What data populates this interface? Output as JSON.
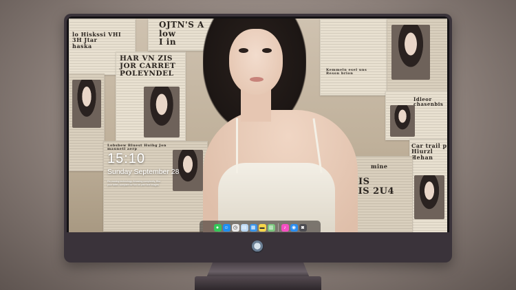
{
  "lockscreen": {
    "time": "15:10",
    "date": "Sunday September 28",
    "note_lines": [
      "Re-moving technology, Amazing complexity, Blur",
      "your label, compare for fun on prev line images"
    ]
  },
  "wallpaper": {
    "headlines": {
      "top_center": "OJTN'S A\nlow\nI in",
      "left_big": "HAR VN ZIS\nJOR CARRET\nPOLEYNDEL",
      "top_left": "lo Hiskssi VHI\n3H Jtar\nhaska",
      "mid_left": "Lobsbew Bluest Huibg Jon\nmaunetl aerp",
      "right_car": "Car trail p\nHiurzl\nЯehan",
      "right_mid": "Idleor\nchasenbis",
      "right_small": "Kemmeln esel uns\nReson brion",
      "bottom_right": "ZIS\nLIS 2U4",
      "right_mine": "mine"
    }
  },
  "dock": {
    "apps": [
      {
        "name": "messages",
        "glyph": "●",
        "color": "#34c759"
      },
      {
        "name": "finder",
        "glyph": "☺",
        "color": "#1e8ef0"
      },
      {
        "name": "clock",
        "glyph": "◷",
        "color": "#e8e8e8"
      },
      {
        "name": "preview",
        "glyph": "▤",
        "color": "#b9d6f2"
      },
      {
        "name": "claquette",
        "glyph": "▦",
        "color": "#3a94e8"
      },
      {
        "name": "notes",
        "glyph": "▬",
        "color": "#f6d64a"
      },
      {
        "name": "photos",
        "glyph": "▥",
        "color": "#7bc67e"
      },
      {
        "name": "music",
        "glyph": "♪",
        "color": "#f54ec2"
      },
      {
        "name": "safari",
        "glyph": "◉",
        "color": "#2a8df0"
      },
      {
        "name": "camera",
        "glyph": "◙",
        "color": "#4d4d52"
      }
    ]
  },
  "colors": {
    "bezel": "#141214",
    "frame": "#3a333a",
    "dock_bg": "rgba(40,34,32,0.55)"
  }
}
